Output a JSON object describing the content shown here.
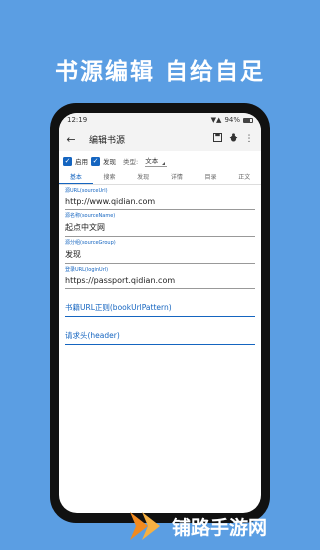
{
  "headline": "书源编辑  自给自足",
  "status_bar": {
    "time": "12:19",
    "battery": "94%"
  },
  "app_bar": {
    "title": "编辑书源"
  },
  "options": {
    "enabled_label": "启用",
    "discover_label": "发现",
    "type_label": "类型:",
    "type_value": "文本"
  },
  "tabs": [
    "基本",
    "搜索",
    "发现",
    "详情",
    "目录",
    "正文"
  ],
  "fields": [
    {
      "hint": "源URL(sourceUrl)",
      "value": "http://www.qidian.com"
    },
    {
      "hint": "源名称(sourceName)",
      "value": "起点中文网"
    },
    {
      "hint": "源分组(sourceGroup)",
      "value": "发现"
    },
    {
      "hint": "登录URL(loginUrl)",
      "value": "https://passport.qidian.com"
    }
  ],
  "placeholders": [
    "书籍URL正则(bookUrlPattern)",
    "请求头(header)"
  ],
  "watermark": "铺路手游网",
  "colors": {
    "background": "#5b9ee3",
    "accent": "#1565c0",
    "watermark_orange": "#f28a1f"
  }
}
